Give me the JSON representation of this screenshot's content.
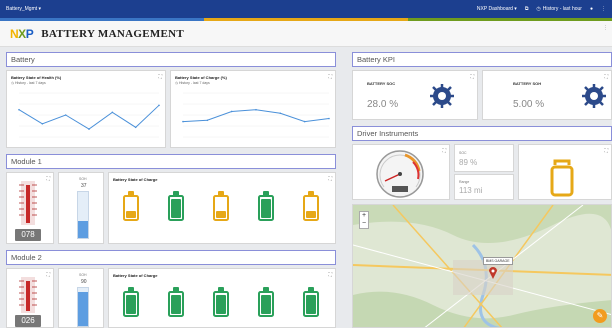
{
  "topbar": {
    "version": "Battery_Mgmt ▾",
    "dashboard": "NXP Dashboard ▾",
    "history": "History - last hour",
    "colors": [
      "#3a75c4",
      "#e6a817",
      "#6f9c1f"
    ]
  },
  "brand": {
    "logo": "NXP",
    "title": "BATTERY MANAGEMENT"
  },
  "battery_section": {
    "title": "Battery",
    "soh_chart": {
      "title": "Battery State of Health (%)",
      "subtitle": "History - last 7 days",
      "chart_data": {
        "type": "line",
        "values": [
          62,
          30,
          50,
          18,
          56,
          22,
          72
        ],
        "ylim": [
          0,
          100
        ]
      }
    },
    "soc_chart": {
      "title": "Battery State of Charge (%)",
      "subtitle": "History - last 7 days",
      "chart_data": {
        "type": "line",
        "values": [
          35,
          38,
          58,
          62,
          54,
          35,
          42
        ],
        "ylim": [
          0,
          100
        ]
      }
    }
  },
  "kpi": {
    "title": "Battery KPI",
    "soc": {
      "label": "BATTERY SOC",
      "value": "28.0 %"
    },
    "soh": {
      "label": "BATTERY SOH",
      "value": "5.00 %"
    }
  },
  "driver": {
    "title": "Driver Instruments",
    "soc_label": "SOC",
    "soc_value": "89 %",
    "range_label": "Range",
    "range_value": "113 mi",
    "map_label": "BMS GARAGE"
  },
  "module1": {
    "title": "Module 1",
    "temp_value": "078",
    "soh_label": "SOH",
    "soh_value": "37",
    "soh_level": 0.37,
    "soc_title": "Battery State of Charge",
    "cells": [
      {
        "level": 0.4,
        "color": "#e6a817"
      },
      {
        "level": 0.95,
        "color": "#2aa05a"
      },
      {
        "level": 0.4,
        "color": "#e6a817"
      },
      {
        "level": 0.95,
        "color": "#2aa05a"
      },
      {
        "level": 0.4,
        "color": "#e6a817"
      }
    ]
  },
  "module2": {
    "title": "Module 2",
    "temp_value": "026",
    "soh_label": "SOH",
    "soh_value": "90",
    "soh_level": 0.9,
    "soc_title": "Battery State of Charge",
    "cells": [
      {
        "level": 0.95,
        "color": "#2aa05a"
      },
      {
        "level": 0.95,
        "color": "#2aa05a"
      },
      {
        "level": 0.95,
        "color": "#2aa05a"
      },
      {
        "level": 0.95,
        "color": "#2aa05a"
      },
      {
        "level": 0.95,
        "color": "#2aa05a"
      }
    ]
  }
}
